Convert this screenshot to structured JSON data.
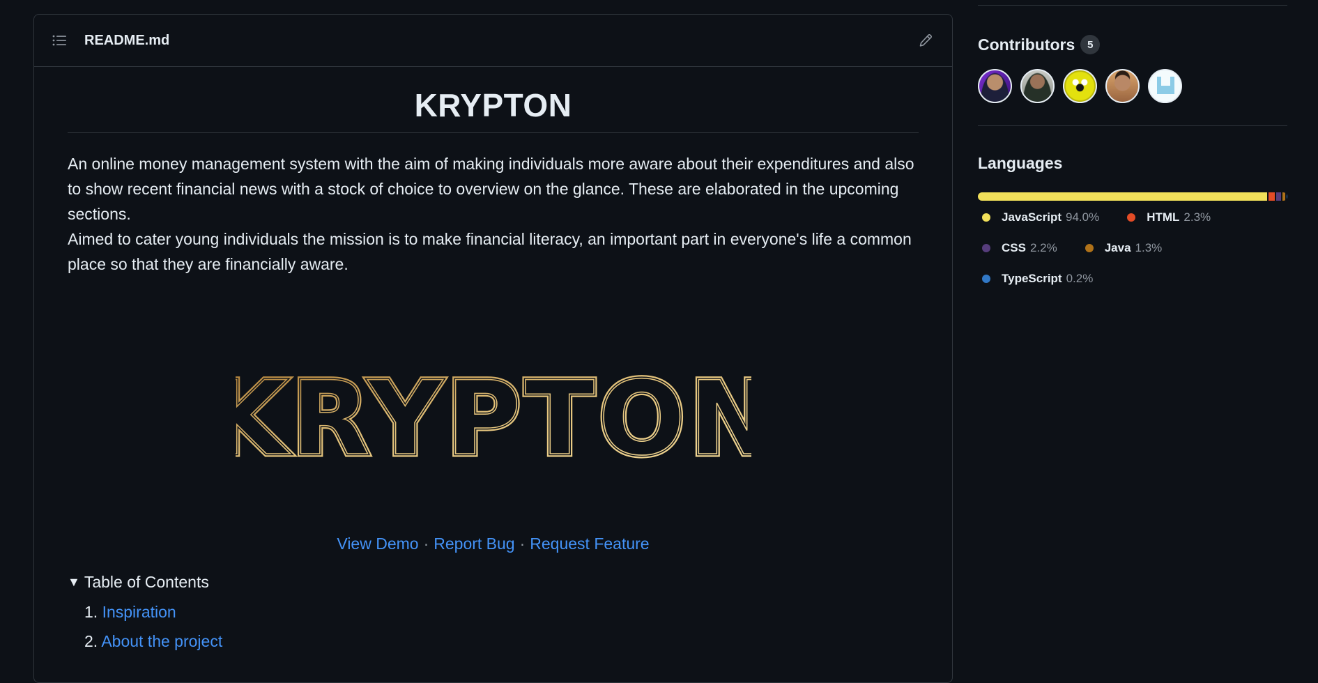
{
  "readme": {
    "filename": "README.md",
    "title": "KRYPTON",
    "description": [
      "An online money management system with the aim of making individuals more aware about their expenditures and also to show recent financial news with a stock of choice to overview on the glance. These are elaborated in the upcoming sections.",
      "Aimed to cater young individuals the mission is to make financial literacy, an important part in everyone's life a common place so that they are financially aware."
    ],
    "logo_text": "KRYPTON",
    "links": {
      "view_demo": "View Demo",
      "report_bug": "Report Bug",
      "request_feature": "Request Feature",
      "separator": "·"
    },
    "toc": {
      "marker": "▼",
      "summary": "Table of Contents",
      "items": [
        {
          "num": "1.",
          "label": "Inspiration"
        },
        {
          "num": "2.",
          "label": "About the project"
        }
      ]
    }
  },
  "sidebar": {
    "contributors": {
      "heading": "Contributors",
      "count": "5"
    },
    "languages": {
      "heading": "Languages",
      "items": [
        {
          "name": "JavaScript",
          "percent": "94.0%",
          "value": 94.0,
          "color": "#f1e05a"
        },
        {
          "name": "HTML",
          "percent": "2.3%",
          "value": 2.3,
          "color": "#e34c26"
        },
        {
          "name": "CSS",
          "percent": "2.2%",
          "value": 2.2,
          "color": "#563d7c"
        },
        {
          "name": "Java",
          "percent": "1.3%",
          "value": 1.3,
          "color": "#b07219"
        },
        {
          "name": "TypeScript",
          "percent": "0.2%",
          "value": 0.2,
          "color": "#3178c6"
        }
      ]
    }
  },
  "icons": {
    "toc": "list-unordered-icon",
    "edit": "pencil-icon"
  }
}
